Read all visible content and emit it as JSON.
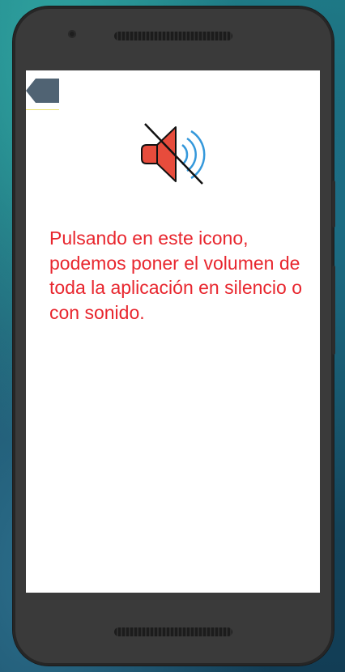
{
  "screen": {
    "back_button": {
      "icon": "back-arrow-icon",
      "color": "#506373"
    },
    "mute_icon": {
      "icon": "speaker-muted-icon",
      "speaker_color": "#e74c3c",
      "wave_color": "#3498db"
    },
    "description": "Pulsando en este icono, podemos poner el volumen de toda la aplicación en silencio o con sonido.",
    "text_color": "#e8262e"
  }
}
